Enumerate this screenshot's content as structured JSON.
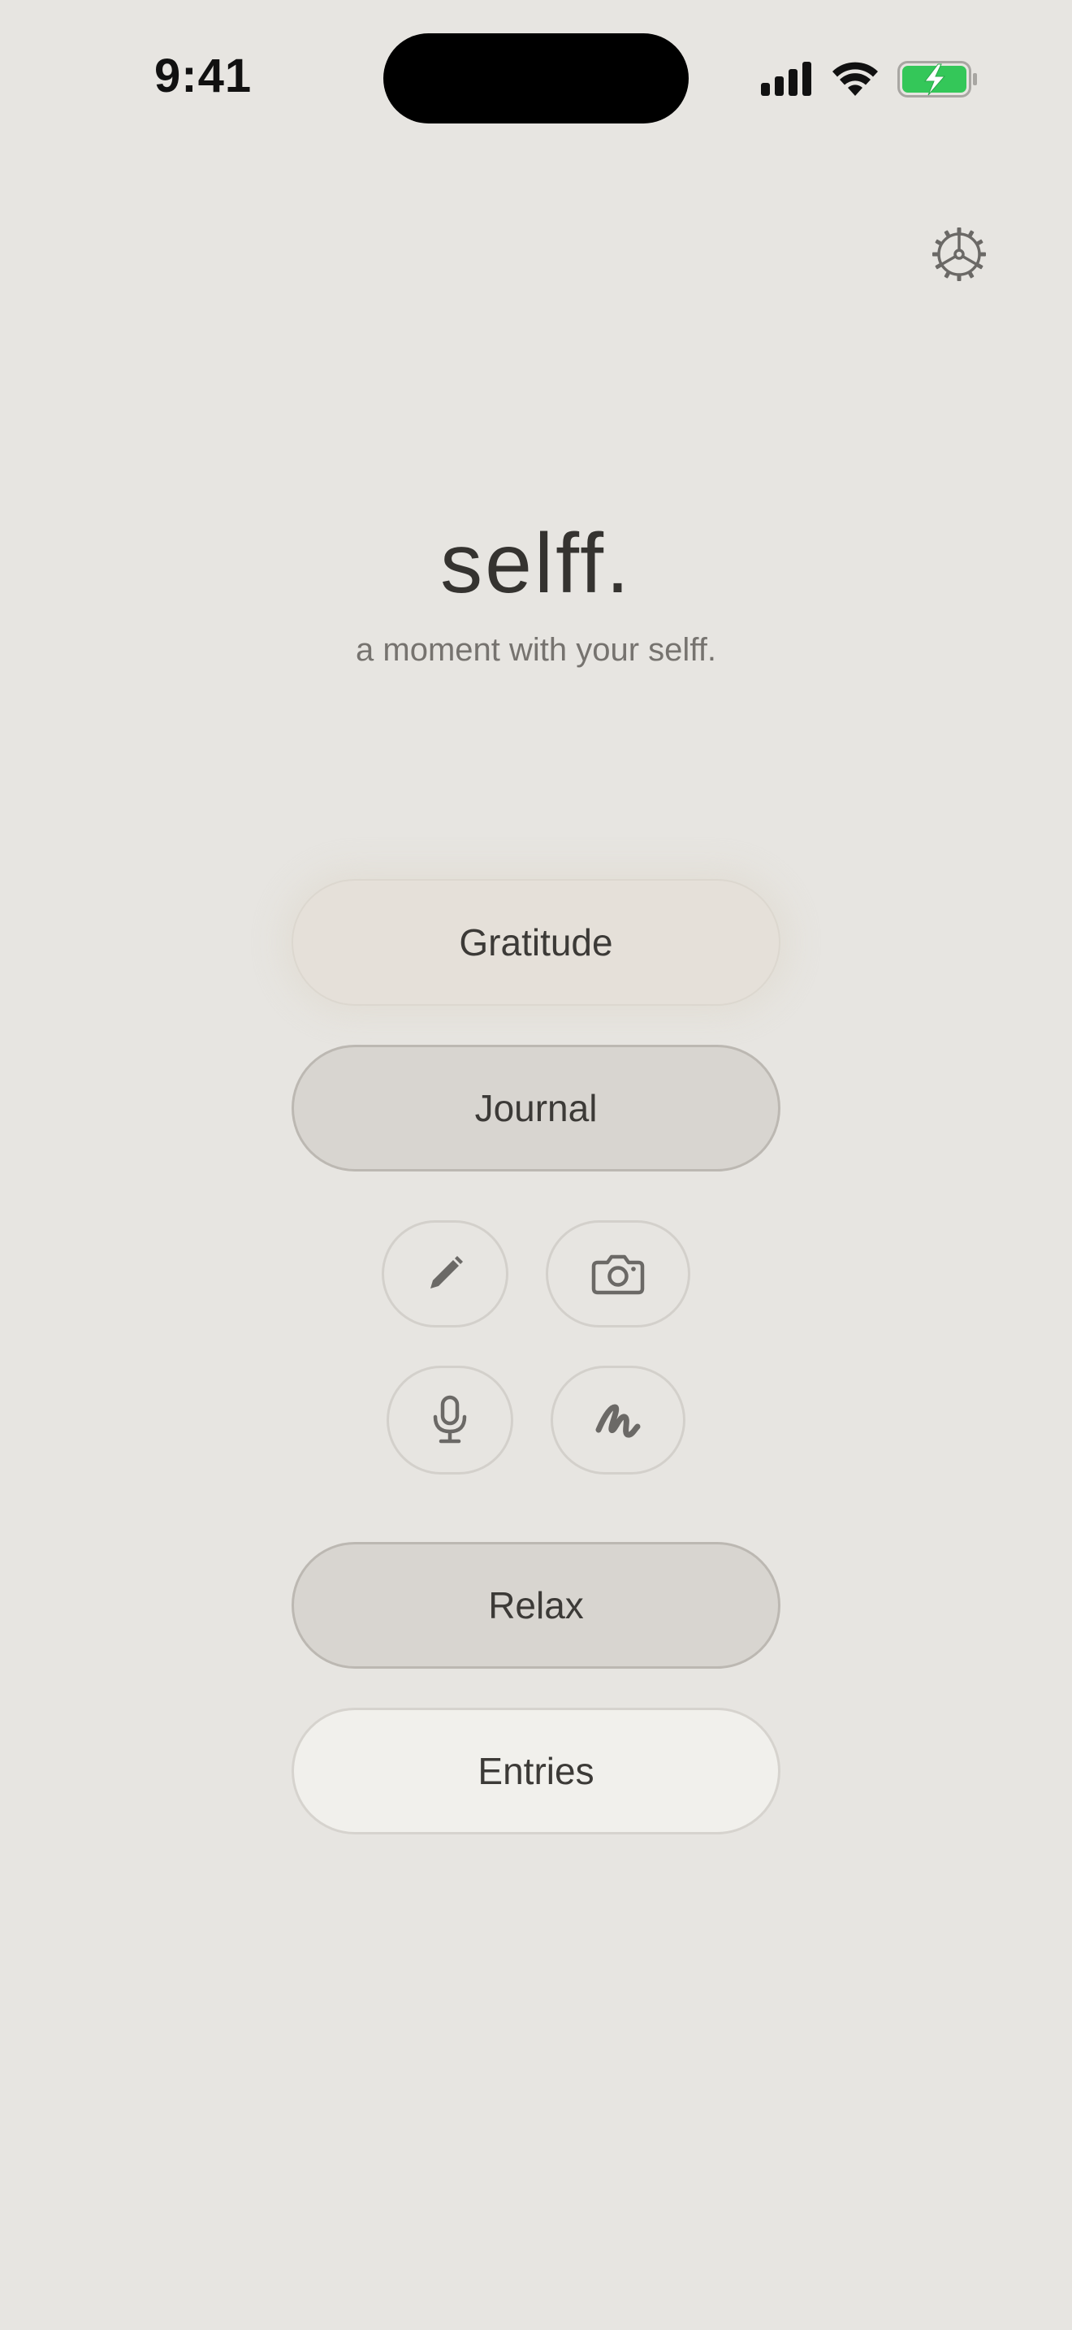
{
  "status_bar": {
    "time": "9:41",
    "battery_color": "#34c759"
  },
  "header": {
    "settings_icon": "gear-icon"
  },
  "brand": {
    "title": "selff.",
    "tagline": "a moment with your selff."
  },
  "menu": {
    "gratitude_label": "Gratitude",
    "journal_label": "Journal",
    "relax_label": "Relax",
    "entries_label": "Entries"
  },
  "journal_modes": [
    {
      "icon": "pencil-icon"
    },
    {
      "icon": "camera-icon"
    },
    {
      "icon": "microphone-icon"
    },
    {
      "icon": "scribble-icon"
    }
  ],
  "colors": {
    "background": "#e7e5e1",
    "gratitude_fill": "#e5e0d9",
    "journal_fill": "#d8d5d0",
    "entries_fill": "#f1f0ec",
    "icon_gray": "#6b6966"
  }
}
